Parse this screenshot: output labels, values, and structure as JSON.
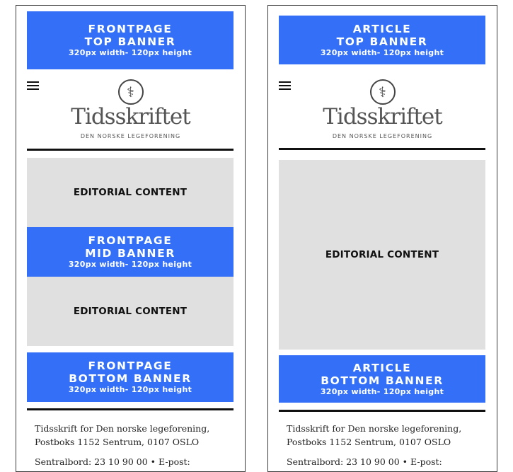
{
  "frontpage": {
    "top_banner": {
      "line1": "FRONTPAGE",
      "line2": "TOP BANNER",
      "line3": "320px width- 120px height"
    },
    "editorial_1": "EDITORIAL CONTENT",
    "mid_banner": {
      "line1": "FRONTPAGE",
      "line2": "MID BANNER",
      "line3": "320px width- 120px height"
    },
    "editorial_2": "EDITORIAL CONTENT",
    "bottom_banner": {
      "line1": "FRONTPAGE",
      "line2": "BOTTOM BANNER",
      "line3": "320px width- 120px height"
    }
  },
  "article": {
    "top_banner": {
      "line1": "ARTICLE",
      "line2": "TOP BANNER",
      "line3": "320px width- 120px height"
    },
    "editorial": "EDITORIAL CONTENT",
    "bottom_banner": {
      "line1": "ARTICLE",
      "line2": "BOTTOM BANNER",
      "line3": "320px width- 120px height"
    }
  },
  "logo": {
    "symbol": "⚕",
    "word": "Tidsskriftet",
    "sub": "DEN NORSKE LEGEFORENING"
  },
  "footer": {
    "line1": "Tidsskrift for Den norske legeforening,",
    "line2": "Postboks 1152 Sentrum, 0107 OSLO",
    "line3": "Sentralbord: 23 10 90 00 • E-post:"
  },
  "colors": {
    "banner": "#3370f7",
    "editorial": "#e0e0e0"
  }
}
